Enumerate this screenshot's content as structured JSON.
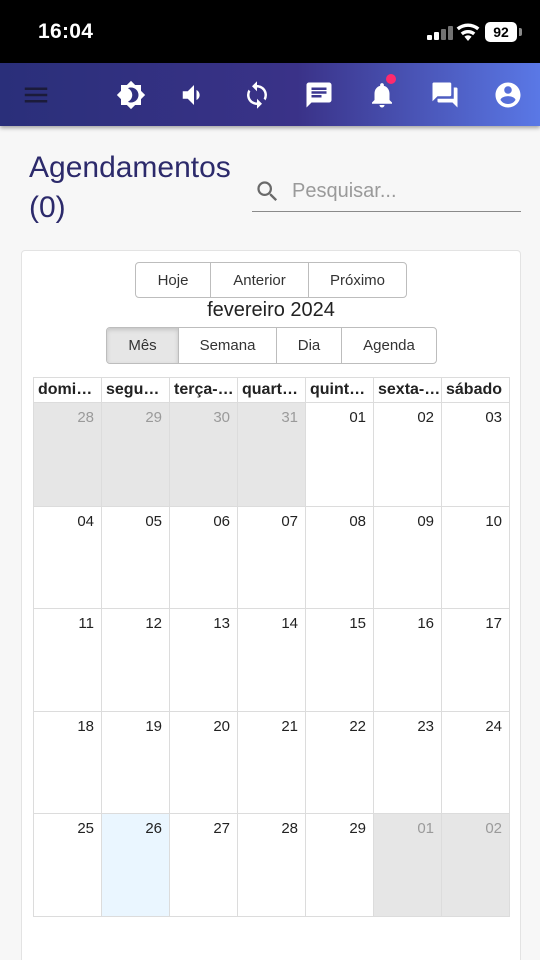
{
  "status_bar": {
    "time": "16:04",
    "battery": "92"
  },
  "app_bar": {
    "icons": [
      "menu-icon",
      "brightness-icon",
      "volume-icon",
      "sync-icon",
      "message-icon",
      "notification-bell-icon",
      "forum-icon",
      "account-circle-icon"
    ],
    "notification_dot_color": "#ff2a6d"
  },
  "page": {
    "title": "Agendamentos (0)",
    "search_placeholder": "Pesquisar..."
  },
  "calendar": {
    "nav": {
      "today": "Hoje",
      "prev": "Anterior",
      "next": "Próximo"
    },
    "label": "fevereiro 2024",
    "views": {
      "month": "Mês",
      "week": "Semana",
      "day": "Dia",
      "agenda": "Agenda",
      "active": "Mês"
    },
    "weekdays": [
      "domingo",
      "segunda-feira",
      "terça-feira",
      "quarta-feira",
      "quinta-feira",
      "sexta-feira",
      "sábado"
    ],
    "weeks": [
      [
        {
          "d": "28",
          "off": true
        },
        {
          "d": "29",
          "off": true
        },
        {
          "d": "30",
          "off": true
        },
        {
          "d": "31",
          "off": true
        },
        {
          "d": "01"
        },
        {
          "d": "02"
        },
        {
          "d": "03"
        }
      ],
      [
        {
          "d": "04"
        },
        {
          "d": "05"
        },
        {
          "d": "06"
        },
        {
          "d": "07"
        },
        {
          "d": "08"
        },
        {
          "d": "09"
        },
        {
          "d": "10"
        }
      ],
      [
        {
          "d": "11"
        },
        {
          "d": "12"
        },
        {
          "d": "13"
        },
        {
          "d": "14"
        },
        {
          "d": "15"
        },
        {
          "d": "16"
        },
        {
          "d": "17"
        }
      ],
      [
        {
          "d": "18"
        },
        {
          "d": "19"
        },
        {
          "d": "20"
        },
        {
          "d": "21"
        },
        {
          "d": "22"
        },
        {
          "d": "23"
        },
        {
          "d": "24"
        }
      ],
      [
        {
          "d": "25"
        },
        {
          "d": "26",
          "today": true
        },
        {
          "d": "27"
        },
        {
          "d": "28"
        },
        {
          "d": "29"
        },
        {
          "d": "01",
          "off": true
        },
        {
          "d": "02",
          "off": true
        }
      ]
    ],
    "colors": {
      "off_range": "#e6e6e6",
      "today": "#eaf6ff"
    }
  }
}
